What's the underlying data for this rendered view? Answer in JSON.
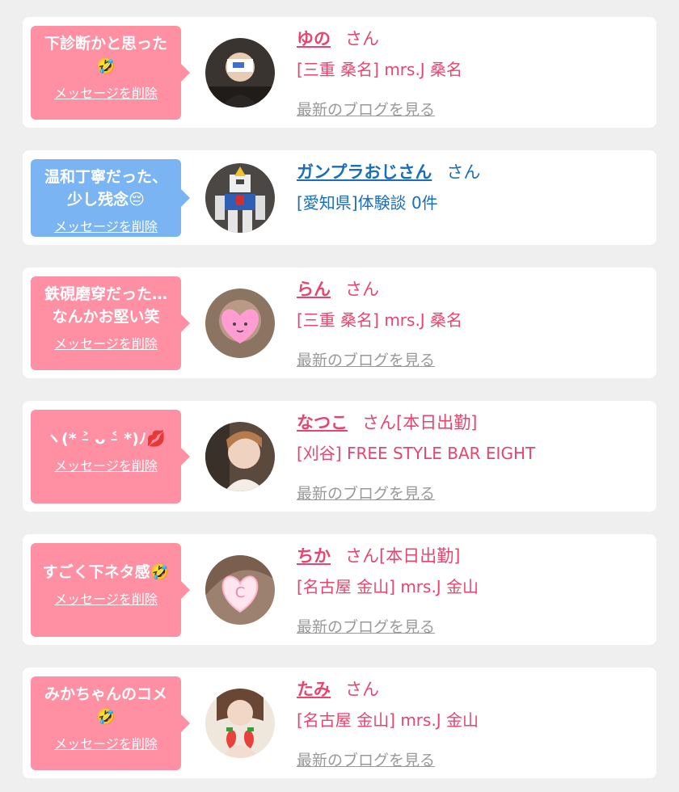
{
  "colors": {
    "pink": "#ff8fa3",
    "blue": "#7ab4f2",
    "name_pink": "#e8456e",
    "name_blue": "#1a6eb9",
    "muted_link": "#999999"
  },
  "delete_label": "メッセージを削除",
  "blog_label": "最新のブログを見る",
  "entries": [
    {
      "bubble_text": "下診断かと思った\n🤣",
      "bubble_color": "pink",
      "delete_label": "メッセージを削除",
      "avatar": "avatar-man-with-card-icon",
      "name": "ゆの",
      "suffix": "さん",
      "shop": "[三重 桑名] mrs.J 桑名",
      "blog_label": "最新のブログを見る",
      "name_color": "pink"
    },
    {
      "bubble_text": "温和丁寧だった、\n少し残念😔",
      "bubble_color": "blue",
      "delete_label": "メッセージを削除",
      "avatar": "avatar-robot-model-icon",
      "name": "ガンプラおじさん",
      "suffix": "さん",
      "shop": "[愛知県]体験談 0件",
      "blog_label": "",
      "name_color": "blue"
    },
    {
      "bubble_text": "鉄硯磨穿だった…\nなんかお堅い笑",
      "bubble_color": "pink",
      "delete_label": "メッセージを削除",
      "avatar": "avatar-heart-face-icon",
      "name": "らん",
      "suffix": "さん",
      "shop": "[三重 桑名] mrs.J 桑名",
      "blog_label": "最新のブログを見る",
      "name_color": "pink"
    },
    {
      "bubble_text": "ヽ(* ˃̵ ᴗ ˂̵ *)ﾉ💋",
      "bubble_color": "pink",
      "delete_label": "メッセージを削除",
      "avatar": "avatar-woman-photo-icon",
      "name": "なつこ",
      "suffix": "さん[本日出勤]",
      "shop": "[刈谷] FREE STYLE BAR EIGHT",
      "blog_label": "最新のブログを見る",
      "name_color": "pink"
    },
    {
      "bubble_text": "すごく下ネタ感🤣",
      "bubble_color": "pink",
      "delete_label": "メッセージを削除",
      "avatar": "avatar-c-heart-icon",
      "name": "ちか",
      "suffix": "さん[本日出勤]",
      "shop": "[名古屋 金山] mrs.J 金山",
      "blog_label": "最新のブログを見る",
      "name_color": "pink"
    },
    {
      "bubble_text": "みかちゃんのコメ\n🤣",
      "bubble_color": "pink",
      "delete_label": "メッセージを削除",
      "avatar": "avatar-strawberry-icon",
      "name": "たみ",
      "suffix": "さん",
      "shop": "[名古屋 金山] mrs.J 金山",
      "blog_label": "最新のブログを見る",
      "name_color": "pink"
    }
  ]
}
